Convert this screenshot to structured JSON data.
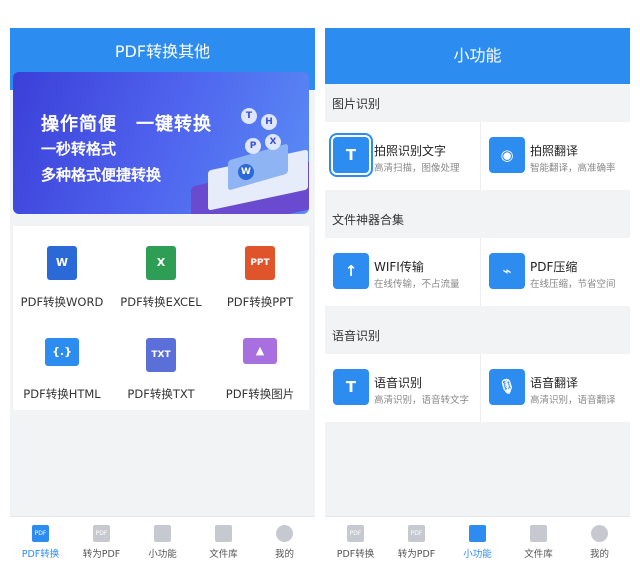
{
  "left_screen": {
    "header_title": "PDF转换其他",
    "banner": {
      "line1": "操作简便　一键转换",
      "line2": "一秒转格式",
      "line3": "多种格式便捷转换",
      "bubbles": [
        "T",
        "H",
        "X",
        "P",
        "W"
      ]
    },
    "converters": [
      {
        "label": "PDF转换WORD",
        "icon_text": "W",
        "icon": "word-file-icon",
        "color": "#2b68d8"
      },
      {
        "label": "PDF转换EXCEL",
        "icon_text": "X",
        "icon": "excel-file-icon",
        "color": "#2e9e55"
      },
      {
        "label": "PDF转换PPT",
        "icon_text": "PPT",
        "icon": "ppt-file-icon",
        "color": "#e0542c"
      },
      {
        "label": "PDF转换HTML",
        "icon_text": "{.}",
        "icon": "html-monitor-icon",
        "color": "#2d8cf0"
      },
      {
        "label": "PDF转换TXT",
        "icon_text": "TXT",
        "icon": "txt-file-icon",
        "color": "#5a6fd8"
      },
      {
        "label": "PDF转换图片",
        "icon_text": "▲",
        "icon": "image-file-icon",
        "color": "#a86fe0"
      }
    ],
    "tabs": [
      {
        "label": "PDF转换",
        "icon": "pdf-icon",
        "active": true
      },
      {
        "label": "转为PDF",
        "icon": "to-pdf-icon",
        "active": false
      },
      {
        "label": "小功能",
        "icon": "grid-icon",
        "active": false
      },
      {
        "label": "文件库",
        "icon": "library-icon",
        "active": false
      },
      {
        "label": "我的",
        "icon": "user-icon",
        "active": false
      }
    ]
  },
  "right_screen": {
    "header_title": "小功能",
    "sections": [
      {
        "title": "图片识别",
        "items": [
          {
            "title": "拍照识别文字",
            "subtitle": "高清扫描，图像处理",
            "icon": "ocr-text-icon",
            "icon_text": "T"
          },
          {
            "title": "拍照翻译",
            "subtitle": "智能翻译，高准确率",
            "icon": "camera-icon",
            "icon_text": "◉"
          }
        ]
      },
      {
        "title": "文件神器合集",
        "items": [
          {
            "title": "WIFI传输",
            "subtitle": "在线传输，不占流量",
            "icon": "wifi-transfer-icon",
            "icon_text": "↑"
          },
          {
            "title": "PDF压缩",
            "subtitle": "在线压缩，节省空间",
            "icon": "pdf-compress-icon",
            "icon_text": "⌁"
          }
        ]
      },
      {
        "title": "语音识别",
        "items": [
          {
            "title": "语音识别",
            "subtitle": "高清识别，语音转文字",
            "icon": "voice-recognition-icon",
            "icon_text": "T"
          },
          {
            "title": "语音翻译",
            "subtitle": "高清识别，语音翻译",
            "icon": "voice-translate-icon",
            "icon_text": "🎙"
          }
        ]
      }
    ],
    "tabs": [
      {
        "label": "PDF转换",
        "icon": "pdf-icon",
        "active": false
      },
      {
        "label": "转为PDF",
        "icon": "to-pdf-icon",
        "active": false
      },
      {
        "label": "小功能",
        "icon": "grid-icon",
        "active": true
      },
      {
        "label": "文件库",
        "icon": "library-icon",
        "active": false
      },
      {
        "label": "我的",
        "icon": "user-icon",
        "active": false
      }
    ]
  },
  "colors": {
    "primary": "#2d8cf0",
    "tab_inactive": "#c6c9cf",
    "background": "#f2f3f5"
  }
}
